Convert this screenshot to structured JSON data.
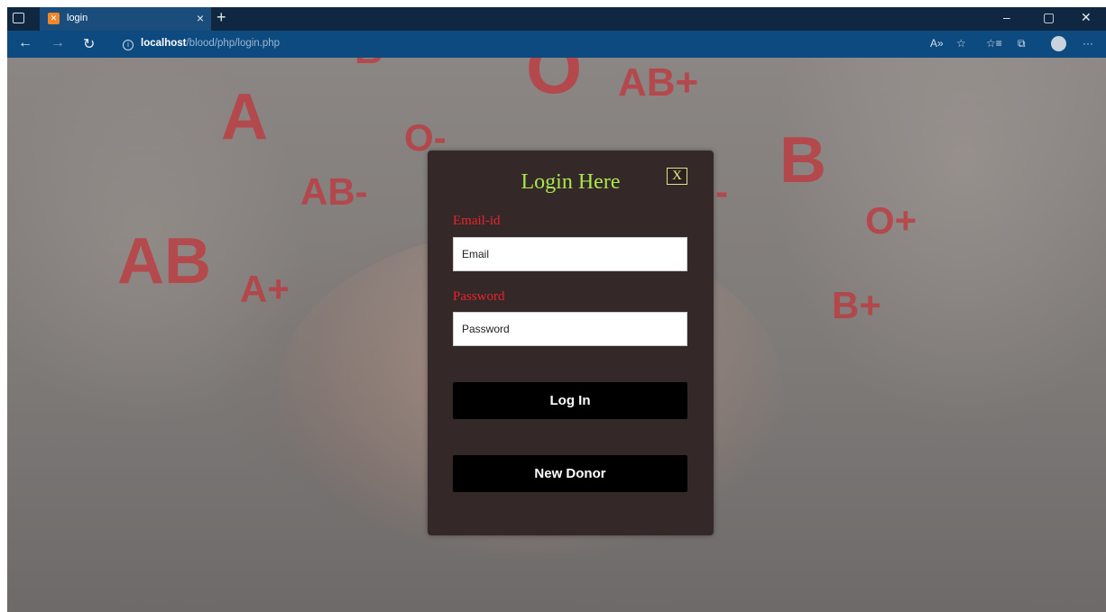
{
  "browser": {
    "tab_title": "login",
    "tab_close": "×",
    "new_tab": "+",
    "url_host": "localhost",
    "url_path": "/blood/php/login.php",
    "window_controls": [
      "–",
      "▢",
      "✕"
    ]
  },
  "background_labels": [
    "A",
    "O",
    "AB+",
    "O-",
    "AB-",
    "B",
    "O+",
    "AB",
    "A+",
    "B+",
    "-",
    "B"
  ],
  "login": {
    "title": "Login Here",
    "close_label": "X",
    "email_label": "Email-id",
    "email_placeholder": "Email",
    "password_label": "Password",
    "password_placeholder": "Password",
    "login_button": "Log In",
    "new_donor_button": "New Donor"
  },
  "colors": {
    "modal_bg": "#352828",
    "title": "#a9e84a",
    "label": "#e8242c",
    "button_bg": "#000000",
    "close_border": "#e8e08a"
  }
}
